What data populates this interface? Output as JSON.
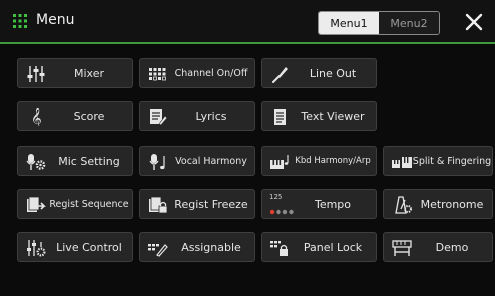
{
  "header": {
    "title": "Menu",
    "tabs": [
      {
        "label": "Menu1",
        "active": true
      },
      {
        "label": "Menu2",
        "active": false
      }
    ]
  },
  "colors": {
    "accent_green": "#3c9a3c",
    "button_bg": "#262626",
    "tempo_red": "#e0402e"
  },
  "buttons": {
    "mixer": {
      "label": "Mixer",
      "icon": "mixer-faders-icon"
    },
    "channel_onoff": {
      "label": "Channel On/Off",
      "icon": "channel-grid-icon"
    },
    "line_out": {
      "label": "Line Out",
      "icon": "line-out-plug-icon"
    },
    "score": {
      "label": "Score",
      "icon": "treble-clef-icon"
    },
    "lyrics": {
      "label": "Lyrics",
      "icon": "lyrics-document-icon"
    },
    "text_viewer": {
      "label": "Text Viewer",
      "icon": "text-document-icon"
    },
    "mic_setting": {
      "label": "Mic Setting",
      "icon": "mic-gear-icon"
    },
    "vocal_harmony": {
      "label": "Vocal Harmony",
      "icon": "mic-note-icon"
    },
    "kbd_harmony": {
      "label": "Kbd Harmony/Arp",
      "icon": "keyboard-note-icon"
    },
    "split_fingering": {
      "label": "Split & Fingering",
      "icon": "keyboard-split-icon"
    },
    "regist_sequence": {
      "label": "Regist Sequence",
      "icon": "registration-sequence-icon"
    },
    "regist_freeze": {
      "label": "Regist Freeze",
      "icon": "registration-lock-icon"
    },
    "tempo": {
      "label": "Tempo",
      "value": "125",
      "icon": "tempo-dots-icon"
    },
    "metronome": {
      "label": "Metronome",
      "icon": "metronome-icon"
    },
    "live_control": {
      "label": "Live Control",
      "icon": "live-control-knobs-icon"
    },
    "assignable": {
      "label": "Assignable",
      "icon": "assignable-pen-icon"
    },
    "panel_lock": {
      "label": "Panel Lock",
      "icon": "panel-lock-icon"
    },
    "demo": {
      "label": "Demo",
      "icon": "demo-keyboard-stand-icon"
    }
  }
}
